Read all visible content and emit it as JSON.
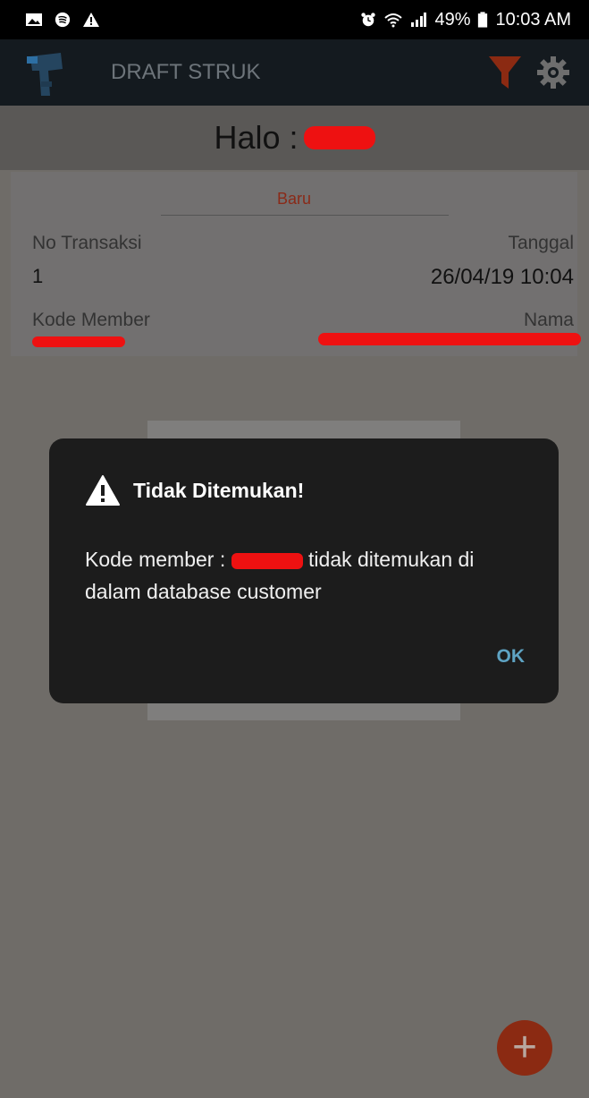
{
  "status_bar": {
    "battery": "49%",
    "time": "10:03 AM",
    "icons_left": [
      "image-icon",
      "spotify-icon",
      "warning-icon"
    ],
    "icons_right": [
      "alarm-icon",
      "wifi-icon",
      "signal-icon",
      "battery-icon"
    ]
  },
  "app_bar": {
    "title": "DRAFT STRUK",
    "icons": [
      "app-logo-icon",
      "filter-icon",
      "gear-icon"
    ]
  },
  "greeting": {
    "label": "Halo :"
  },
  "transaction_card": {
    "status": "Baru",
    "no_transaksi_label": "No Transaksi",
    "no_transaksi_value": "1",
    "tanggal_label": "Tanggal",
    "tanggal_value": "26/04/19 10:04",
    "kode_member_label": "Kode Member",
    "nama_label": "Nama"
  },
  "dialog": {
    "title": "Tidak Ditemukan!",
    "message_prefix": "Kode member :",
    "message_suffix": "tidak ditemukan di dalam database customer",
    "ok_label": "OK"
  },
  "fab": {
    "label": "+"
  },
  "colors": {
    "accent": "#8b2a12",
    "dialog_bg": "#1c1c1c",
    "ok_button": "#5ea3c3",
    "redaction": "#ee1111"
  }
}
